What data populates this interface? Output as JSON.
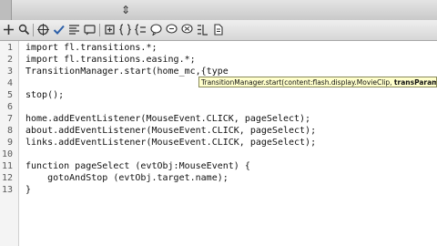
{
  "toolbar": {
    "icons": [
      "cross",
      "magnifier",
      "target",
      "checkmark",
      "lines",
      "braces",
      "bubble-a",
      "bubble-b",
      "bubble-c",
      "brackets",
      "doc"
    ]
  },
  "gutter": {
    "line_numbers": [
      "1",
      "2",
      "3",
      "4",
      "5",
      "6",
      "7",
      "8",
      "9",
      "10",
      "11",
      "12",
      "13"
    ]
  },
  "code": {
    "lines": [
      "import fl.transitions.*;",
      "import fl.transitions.easing.*;",
      "TransitionManager.start(home_mc,{type",
      "",
      "stop();",
      "",
      "home.addEventListener(MouseEvent.CLICK, pageSelect);",
      "about.addEventListener(MouseEvent.CLICK, pageSelect);",
      "links.addEventListener(MouseEvent.CLICK, pageSelect);",
      "",
      "function pageSelect (evtObj:MouseEvent) {",
      "    gotoAndStop (evtObj.target.name);",
      "}"
    ]
  },
  "hint": {
    "prefix": "TransitionManager.start(content:flash.display.MovieClip, ",
    "bold": "transParams"
  }
}
